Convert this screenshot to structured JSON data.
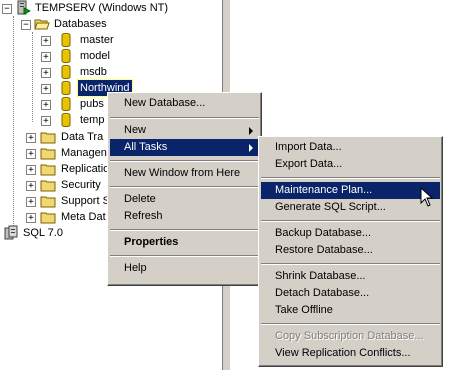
{
  "tree": {
    "server": "TEMPSERV (Windows NT)",
    "databases_folder": "Databases",
    "databases": [
      "master",
      "model",
      "msdb",
      "Northwind",
      "pubs",
      "temp"
    ],
    "folders": [
      "Data Tra",
      "Managen",
      "Replicatio",
      "Security",
      "Support S",
      "Meta Dat"
    ],
    "other_server": "SQL 7.0"
  },
  "context_menu": {
    "items": [
      "New Database...",
      "New",
      "All Tasks",
      "New Window from Here",
      "Delete",
      "Refresh",
      "Properties",
      "Help"
    ]
  },
  "all_tasks_menu": {
    "items": [
      "Import Data...",
      "Export Data...",
      "Maintenance Plan...",
      "Generate SQL Script...",
      "Backup Database...",
      "Restore Database...",
      "Shrink Database...",
      "Detach Database...",
      "Take Offline",
      "Copy Subscription Database...",
      "View Replication Conflicts..."
    ]
  },
  "colors": {
    "highlight": "#0a246a",
    "menu_face": "#d4d0c8",
    "folder": "#f2d672",
    "db": "#e8c400"
  }
}
